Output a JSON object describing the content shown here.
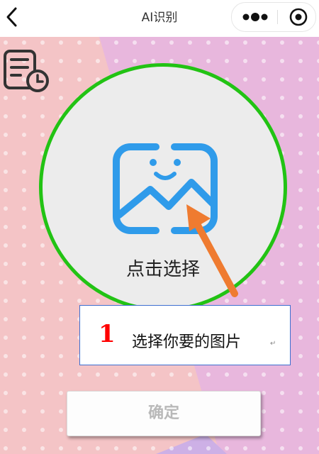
{
  "header": {
    "title": "AI识别"
  },
  "picker": {
    "label": "点击选择"
  },
  "annotation": {
    "number": "1",
    "text": "选择你要的图片",
    "mark": "↵"
  },
  "confirm_button": {
    "label": "确定",
    "enabled": false
  },
  "colors": {
    "circle_border": "#22c314",
    "icon_blue": "#2f9bea",
    "arrow": "#ef7b30",
    "annotation_number": "#ff0000",
    "annotation_border": "#3d6fd0",
    "bg_pink": "#f4c4c6",
    "bg_purple": "#e8b7dd"
  },
  "icons": [
    "back-chevron-icon",
    "more-icon",
    "close-target-icon",
    "history-document-clock-icon",
    "image-smile-icon"
  ]
}
